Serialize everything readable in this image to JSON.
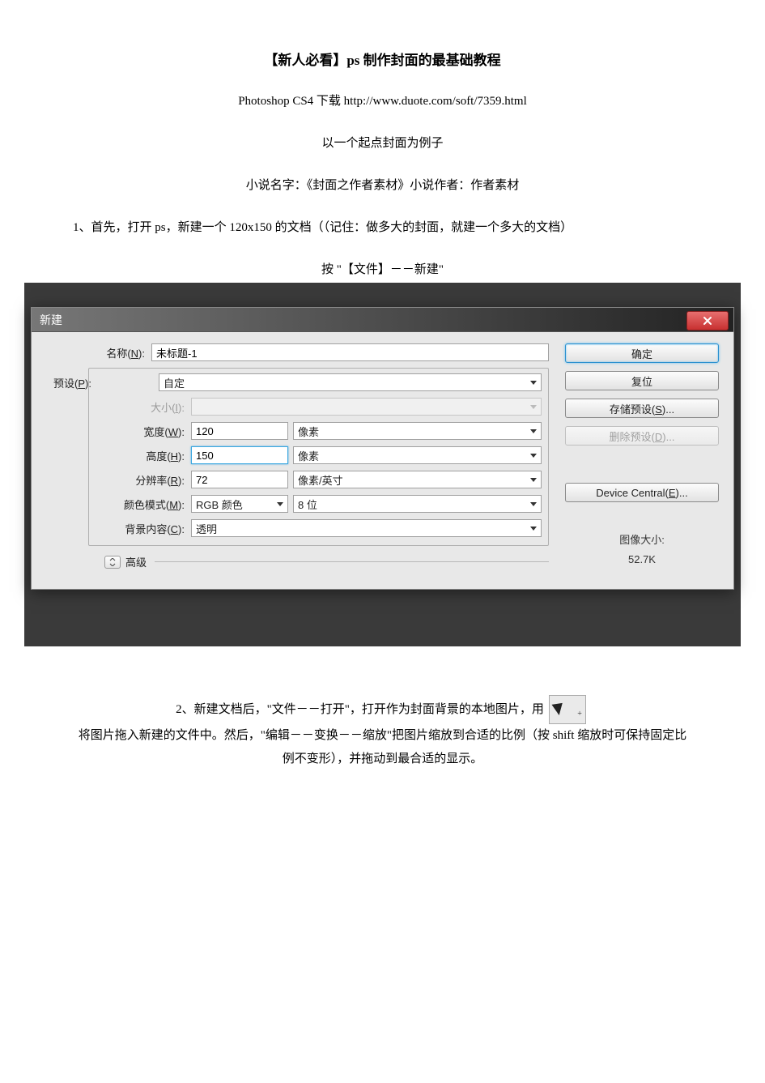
{
  "doc": {
    "title": "【新人必看】ps 制作封面的最基础教程",
    "download_label": "Photoshop CS4 下载",
    "download_url": "http://www.duote.com/soft/7359.html",
    "example_note": "以一个起点封面为例子",
    "novel_line": "小说名字：《封面之作者素材》小说作者：作者素材",
    "step1": "1、首先，打开 ps，新建一个 120x150 的文档（（记住：做多大的封面，就建一个多大的文档）",
    "step1_action": "按 \"【文件】－－新建\"",
    "step2_prefix": "2、新建文档后，\"文件－－打开\"，打开作为封面背景的本地图片，用",
    "step2_rest": "将图片拖入新建的文件中。然后，\"编辑－－变换－－缩放\"把图片缩放到合适的比例（按 shift 缩放时可保持固定比例不变形），并拖动到最合适的显示。"
  },
  "dialog": {
    "title": "新建",
    "labels": {
      "name": "名称(N):",
      "preset": "预设(P):",
      "size": "大小(I):",
      "width": "宽度(W):",
      "height": "高度(H):",
      "resolution": "分辨率(R):",
      "color_mode": "颜色模式(M):",
      "background": "背景内容(C):",
      "advanced": "高级"
    },
    "values": {
      "name": "未标题-1",
      "preset": "自定",
      "size": "",
      "width": "120",
      "height": "150",
      "resolution": "72",
      "color_mode": "RGB 颜色",
      "color_depth": "8 位",
      "background": "透明"
    },
    "units": {
      "width": "像素",
      "height": "像素",
      "resolution": "像素/英寸"
    },
    "buttons": {
      "ok": "确定",
      "reset": "复位",
      "save_preset": "存储预设(S)...",
      "delete_preset": "删除预设(D)...",
      "device_central": "Device Central(E)..."
    },
    "image_size_label": "图像大小:",
    "image_size_value": "52.7K"
  }
}
